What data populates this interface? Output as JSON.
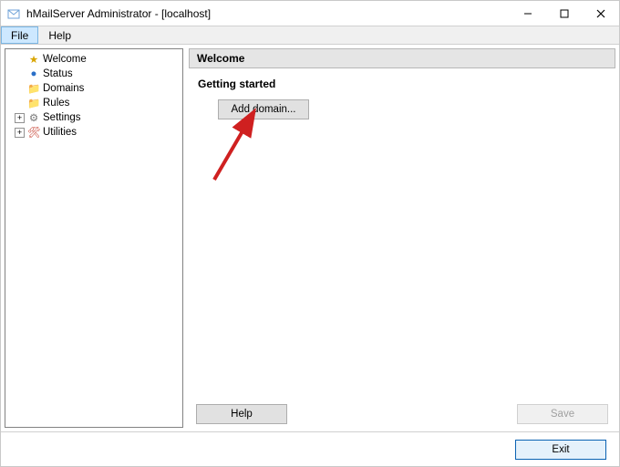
{
  "title": "hMailServer Administrator - [localhost]",
  "menu": {
    "file": "File",
    "help": "Help"
  },
  "tree": {
    "items": [
      {
        "label": "Welcome",
        "icon": "star",
        "color": "#d9a500"
      },
      {
        "label": "Status",
        "icon": "globe",
        "color": "#2a6fc7"
      },
      {
        "label": "Domains",
        "icon": "folder",
        "color": "#e8c04a"
      },
      {
        "label": "Rules",
        "icon": "folder",
        "color": "#e8c04a"
      },
      {
        "label": "Settings",
        "icon": "gear",
        "color": "#777",
        "expandable": true
      },
      {
        "label": "Utilities",
        "icon": "tools",
        "color": "#c43a2b",
        "expandable": true
      }
    ]
  },
  "panel": {
    "title": "Welcome",
    "section": "Getting started",
    "add_domain": "Add domain...",
    "help": "Help",
    "save": "Save"
  },
  "footer": {
    "exit": "Exit"
  }
}
